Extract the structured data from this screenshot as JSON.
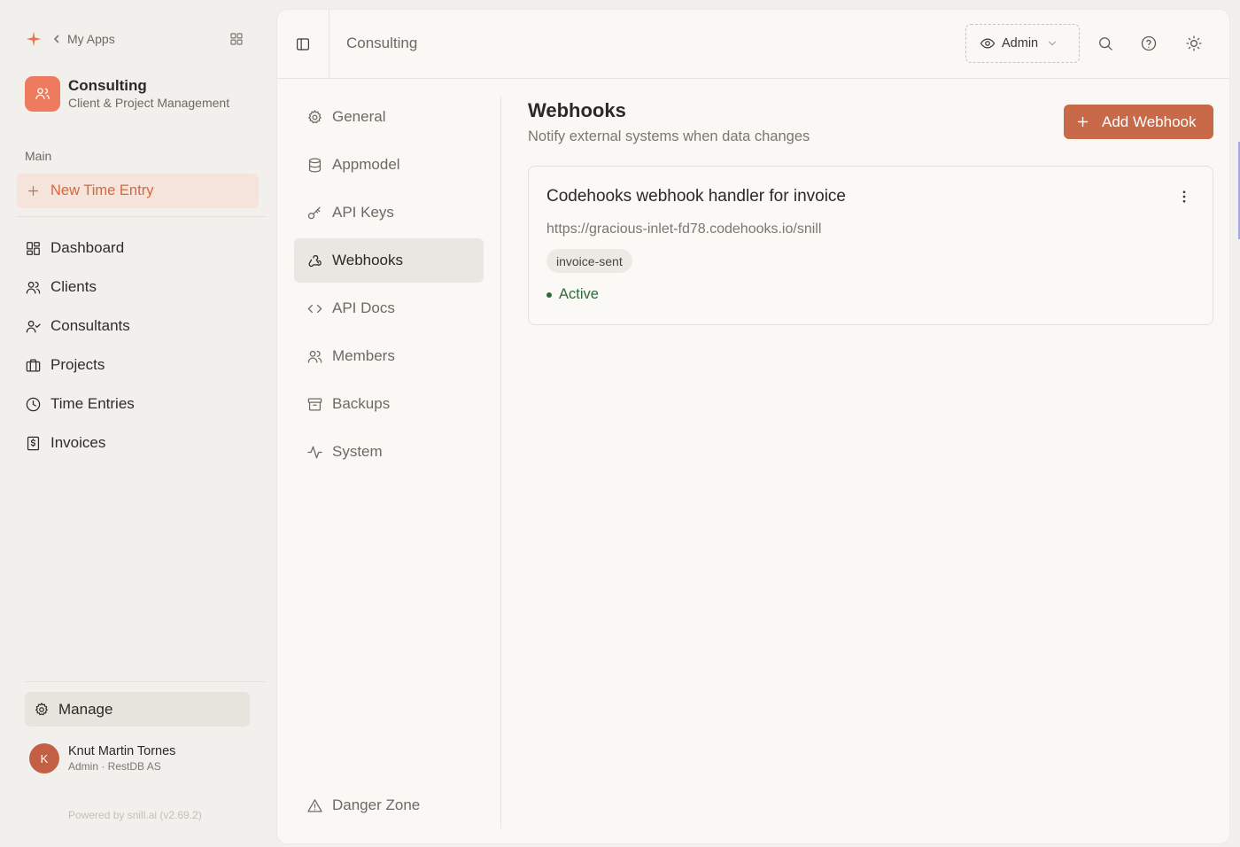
{
  "topnav": {
    "my_apps": "My Apps"
  },
  "app": {
    "name": "Consulting",
    "subtitle": "Client & Project Management"
  },
  "sidebar": {
    "section_label": "Main",
    "new_entry": "New Time Entry",
    "items": [
      {
        "label": "Dashboard",
        "icon": "dashboard-icon"
      },
      {
        "label": "Clients",
        "icon": "users-icon"
      },
      {
        "label": "Consultants",
        "icon": "user-check-icon"
      },
      {
        "label": "Projects",
        "icon": "briefcase-icon"
      },
      {
        "label": "Time Entries",
        "icon": "clock-icon"
      },
      {
        "label": "Invoices",
        "icon": "invoice-icon"
      }
    ],
    "manage": "Manage"
  },
  "user": {
    "initial": "K",
    "name": "Knut Martin Tornes",
    "role": "Admin · RestDB AS"
  },
  "powered_by": "Powered by snill.ai (v2.69.2)",
  "header": {
    "title": "Consulting",
    "role_selector": "Admin"
  },
  "settings_nav": {
    "items": [
      {
        "label": "General",
        "icon": "gear-icon"
      },
      {
        "label": "Appmodel",
        "icon": "database-icon"
      },
      {
        "label": "API Keys",
        "icon": "key-icon"
      },
      {
        "label": "Webhooks",
        "icon": "webhook-icon",
        "active": true
      },
      {
        "label": "API Docs",
        "icon": "code-icon"
      },
      {
        "label": "Members",
        "icon": "users-icon"
      },
      {
        "label": "Backups",
        "icon": "archive-icon"
      },
      {
        "label": "System",
        "icon": "activity-icon"
      }
    ],
    "danger_zone": "Danger Zone"
  },
  "content": {
    "title": "Webhooks",
    "subtitle": "Notify external systems when data changes",
    "add_button": "Add Webhook"
  },
  "webhooks": [
    {
      "name": "Codehooks webhook handler for invoice",
      "url": "https://gracious-inlet-fd78.codehooks.io/snill",
      "events": [
        "invoice-sent"
      ],
      "status": "Active"
    }
  ],
  "colors": {
    "accent": "#c86a49",
    "accent_soft": "#f5e4da",
    "status_active": "#2f6a3c",
    "app_avatar": "#ee7b5e"
  }
}
